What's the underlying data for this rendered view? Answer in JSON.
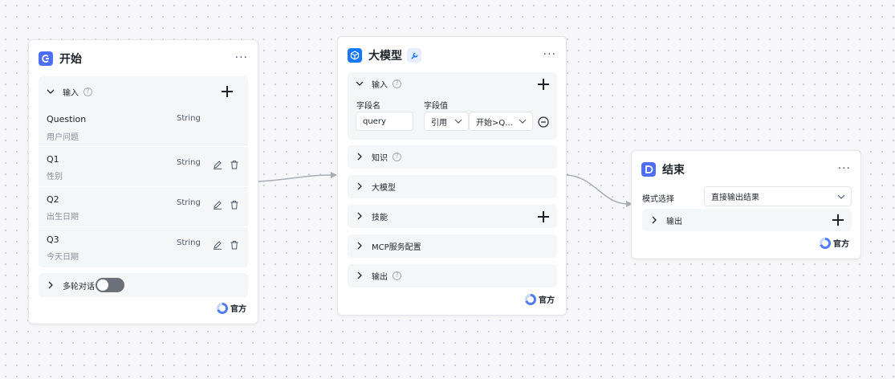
{
  "colors": {
    "accent": "#4f6ef7",
    "llm_icon": "#1677ff",
    "edge": "#a8acb3"
  },
  "start_node": {
    "title": "开始",
    "icon": "start-icon",
    "more": "···",
    "input_section": {
      "label": "输入",
      "help": "?",
      "params": [
        {
          "name": "Question",
          "type": "String",
          "desc": "用户问题"
        },
        {
          "name": "Q1",
          "type": "String",
          "desc": "性别"
        },
        {
          "name": "Q2",
          "type": "String",
          "desc": "出生日期"
        },
        {
          "name": "Q3",
          "type": "String",
          "desc": "今天日期"
        }
      ]
    },
    "multi_turn": {
      "label": "多轮对话",
      "enabled": false
    },
    "badge": "官方"
  },
  "llm_node": {
    "title": "大模型",
    "icon": "cube-icon",
    "more": "···",
    "input_section": {
      "label": "输入",
      "help": "?",
      "field_name_header": "字段名",
      "field_value_header": "字段值",
      "field_name_value": "query",
      "ref_select": "引用",
      "ref_value": "开始>Q..."
    },
    "sections": [
      {
        "label": "知识",
        "help": true,
        "add": false
      },
      {
        "label": "大模型",
        "help": false,
        "add": false
      },
      {
        "label": "技能",
        "help": false,
        "add": true
      },
      {
        "label": "MCP服务配置",
        "help": false,
        "add": false
      },
      {
        "label": "输出",
        "help": true,
        "add": false
      }
    ],
    "badge": "官方"
  },
  "end_node": {
    "title": "结束",
    "icon": "end-icon",
    "more": "···",
    "mode_label": "模式选择",
    "mode_value": "直接输出结果",
    "output_label": "输出",
    "badge": "官方"
  }
}
